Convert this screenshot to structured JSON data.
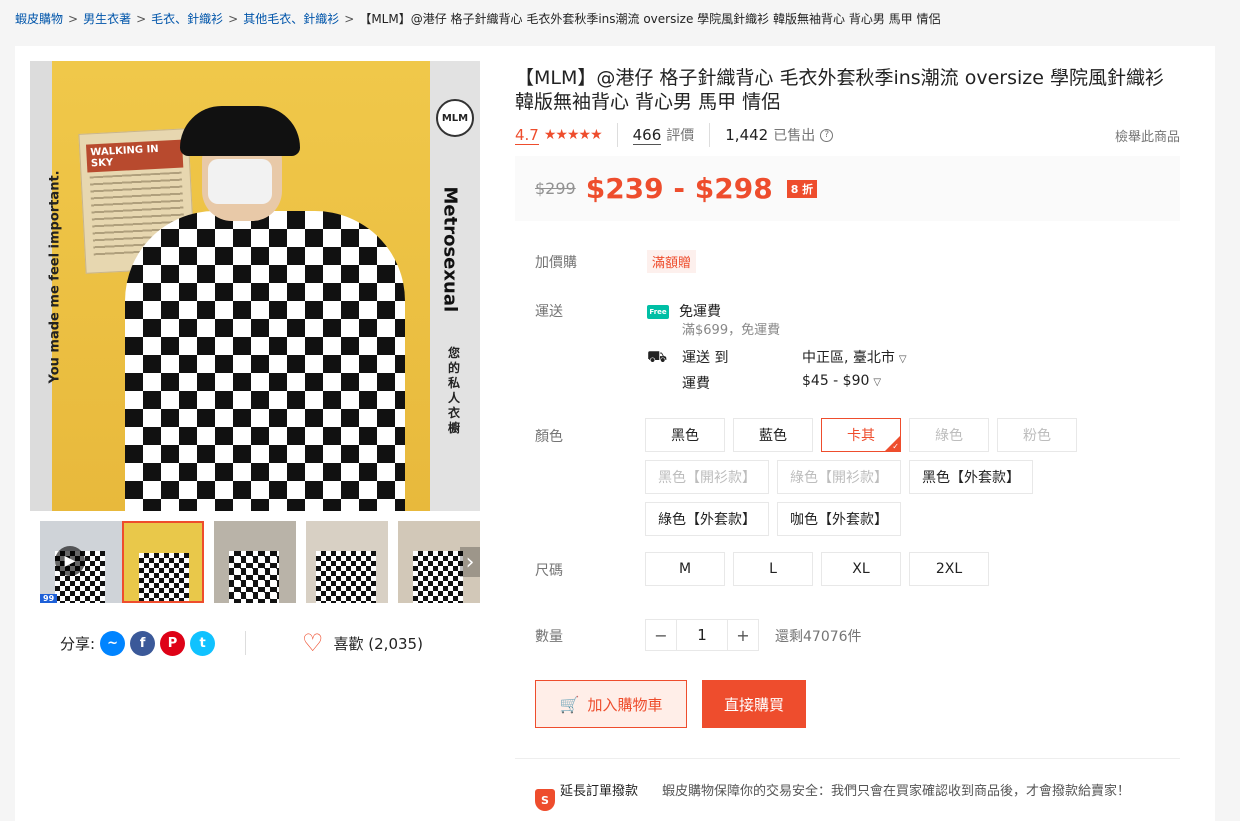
{
  "breadcrumb": {
    "items": [
      "蝦皮購物",
      "男生衣著",
      "毛衣、針織衫",
      "其他毛衣、針織衫"
    ],
    "current": "【MLM】@港仔 格子針織背心 毛衣外套秋季ins潮流 oversize 學院風針織衫 韓版無袖背心 背心男 馬甲 情侶",
    "separator": ">"
  },
  "gallery": {
    "image_texts": {
      "left": "You made me feel important.",
      "right": "Metrosexual",
      "right_cn": "您的私人衣櫥",
      "logo": "MLM",
      "poster": "WALKING IN SKY",
      "badge": "99"
    },
    "thumbnail_count": 5
  },
  "share": {
    "label": "分享:"
  },
  "like": {
    "label": "喜歡 (2,035)"
  },
  "product": {
    "title": "【MLM】@港仔 格子針織背心 毛衣外套秋季ins潮流 oversize 學院風針織衫 韓版無袖背心 背心男 馬甲 情侶",
    "rating": "4.7",
    "stars": "★★★★★",
    "reviews_count": "466",
    "reviews_label": "評價",
    "sold_count": "1,442",
    "sold_label": "已售出",
    "report_label": "檢舉此商品"
  },
  "price": {
    "original": "$299",
    "current": "$239 - $298",
    "discount": "8 折"
  },
  "addon": {
    "label": "加價購",
    "tag": "滿額贈"
  },
  "shipping": {
    "label": "運送",
    "free_title": "免運費",
    "free_sub": "滿$699，免運費",
    "to_label": "運送 到",
    "to_value": "中正區, 臺北市",
    "fee_label": "運費",
    "fee_value": "$45 - $90"
  },
  "color": {
    "label": "顏色",
    "options": [
      "黑色",
      "藍色",
      "卡其",
      "綠色",
      "粉色",
      "黑色【開衫款】",
      "綠色【開衫款】",
      "黑色【外套款】",
      "綠色【外套款】",
      "咖色【外套款】"
    ],
    "selected": "卡其",
    "disabled": [
      "綠色",
      "粉色",
      "黑色【開衫款】",
      "綠色【開衫款】"
    ]
  },
  "size": {
    "label": "尺碼",
    "options": [
      "M",
      "L",
      "XL",
      "2XL"
    ]
  },
  "quantity": {
    "label": "數量",
    "value": "1",
    "minus": "−",
    "plus": "+",
    "stock": "還剩47076件"
  },
  "actions": {
    "add_to_cart": "加入購物車",
    "buy_now": "直接購買"
  },
  "guarantee": {
    "title": "延長訂單撥款",
    "text": "蝦皮購物保障你的交易安全：我們只會在買家確認收到商品後，才會撥款給賣家！"
  },
  "colors": {
    "accent": "#ee4d2d",
    "link": "#0055aa"
  }
}
